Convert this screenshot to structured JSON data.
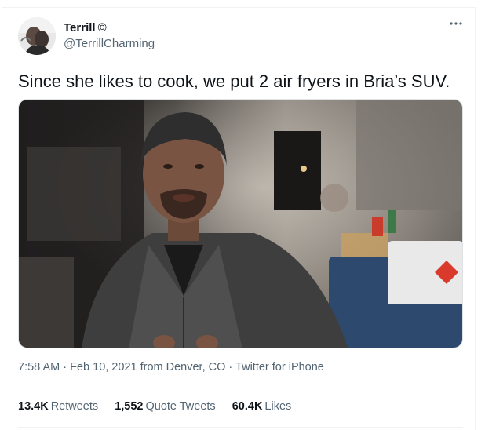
{
  "tweet": {
    "author": {
      "display_name": "Terrill",
      "name_suffix": "©",
      "handle": "@TerrillCharming"
    },
    "more_icon": "ellipsis-icon",
    "text": "Since she likes to cook, we put 2 air fryers in Bria’s SUV.",
    "meta": {
      "time": "7:58 AM",
      "separator1": "·",
      "date": "Feb 10, 2021",
      "location": "from Denver, CO",
      "separator2": "·",
      "source": "Twitter for iPhone"
    },
    "stats": {
      "retweets": {
        "count": "13.4K",
        "label": "Retweets"
      },
      "quote_tweets": {
        "count": "1,552",
        "label": "Quote Tweets"
      },
      "likes": {
        "count": "60.4K",
        "label": "Likes"
      }
    }
  },
  "colors": {
    "text_primary": "#0f1419",
    "text_secondary": "#536471",
    "border": "#eff3f4"
  }
}
